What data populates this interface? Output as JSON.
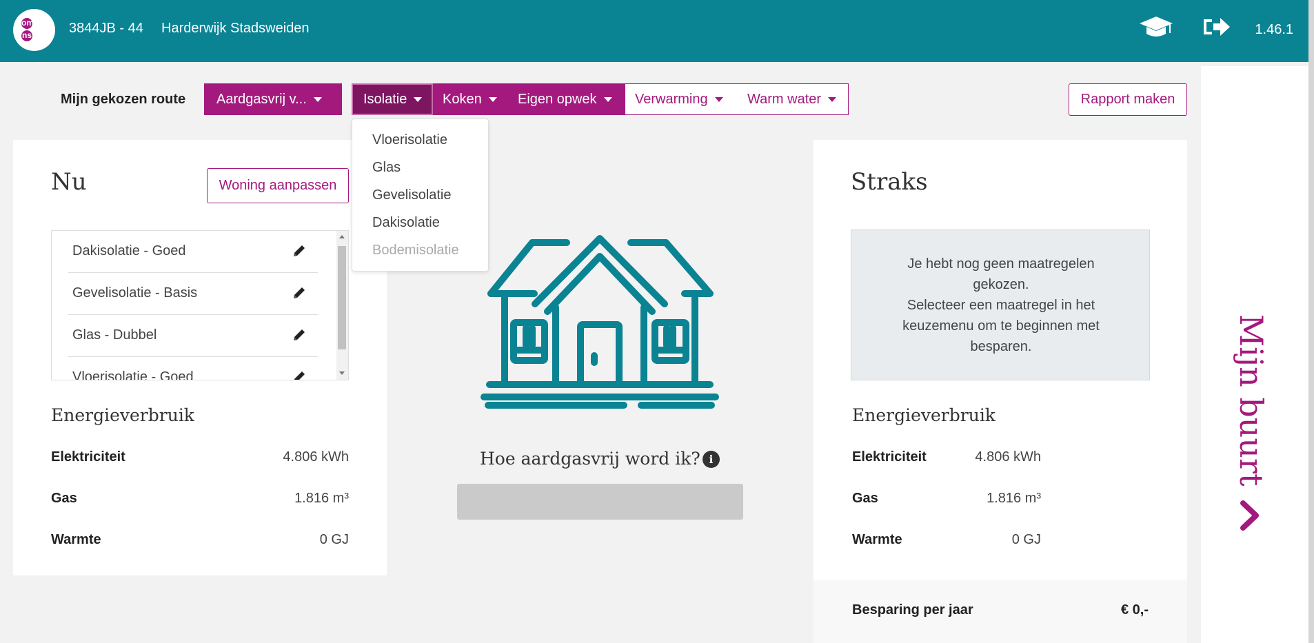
{
  "header": {
    "logo_text": [
      "om",
      "ns"
    ],
    "postcode": "3844JB - 44",
    "neighbourhood": "Harderwijk Stadsweiden",
    "version": "1.46.1",
    "icons": [
      "graduation-cap-icon",
      "sign-out-icon"
    ]
  },
  "route": {
    "label": "Mijn gekozen route",
    "route_select": "Aardgasvrij v...",
    "tabs": [
      {
        "label": "Isolatie",
        "active": true
      },
      {
        "label": "Koken",
        "active": false
      },
      {
        "label": "Eigen opwek",
        "active": false
      },
      {
        "label": "Verwarming",
        "active": false
      },
      {
        "label": "Warm water",
        "active": false
      }
    ],
    "report_button": "Rapport maken"
  },
  "dropdown": {
    "items": [
      {
        "label": "Vloerisolatie",
        "disabled": false
      },
      {
        "label": "Glas",
        "disabled": false
      },
      {
        "label": "Gevelisolatie",
        "disabled": false
      },
      {
        "label": "Dakisolatie",
        "disabled": false
      },
      {
        "label": "Bodemisolatie",
        "disabled": true
      }
    ]
  },
  "now_panel": {
    "title": "Nu",
    "edit_button": "Woning aanpassen",
    "measures": [
      "Dakisolatie - Goed",
      "Gevelisolatie - Basis",
      "Glas - Dubbel",
      "Vloerisolatie - Goed"
    ],
    "energy_title": "Energieverbruik",
    "stats": [
      {
        "label": "Elektriciteit",
        "value": "4.806 kWh"
      },
      {
        "label": "Gas",
        "value": "1.816 m³"
      },
      {
        "label": "Warmte",
        "value": "0 GJ"
      }
    ]
  },
  "center": {
    "question": "Hoe aardgasvrij word ik?",
    "info_icon": "i",
    "house_color": "#0a8393"
  },
  "later_panel": {
    "title": "Straks",
    "empty_message": "Je hebt nog geen maatregelen gekozen.\nSelecteer een maatregel in het keuzemenu om te beginnen met besparen.",
    "empty_line1": "Je hebt nog geen maatregelen",
    "empty_line2": "gekozen.",
    "empty_line3": "Selecteer een maatregel in het",
    "empty_line4": "keuzemenu om te beginnen met",
    "empty_line5": "besparen.",
    "energy_title": "Energieverbruik",
    "stats": [
      {
        "label": "Elektriciteit",
        "value": "4.806 kWh"
      },
      {
        "label": "Gas",
        "value": "1.816 m³"
      },
      {
        "label": "Warmte",
        "value": "0 GJ"
      }
    ],
    "savings_label": "Besparing per jaar",
    "savings_value": "€ 0,-"
  },
  "side": {
    "label": "Mijn buurt"
  },
  "colors": {
    "teal": "#0a8393",
    "magenta": "#a4197d",
    "magenta_dark": "#7e1561"
  }
}
